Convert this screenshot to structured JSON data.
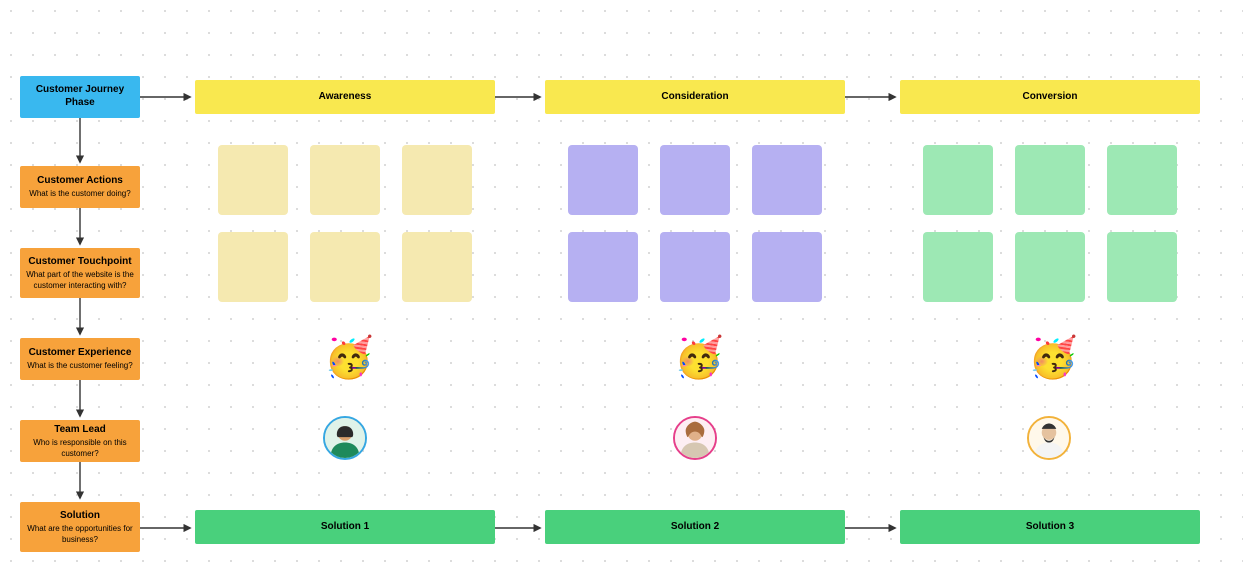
{
  "header": {
    "phase_box": "Customer Journey Phase",
    "phases": [
      "Awareness",
      "Consideration",
      "Conversion"
    ]
  },
  "rows": [
    {
      "title": "Customer Actions",
      "sub": "What is the customer doing?"
    },
    {
      "title": "Customer Touchpoint",
      "sub": "What part of the website is the customer interacting with?"
    },
    {
      "title": "Customer Experience",
      "sub": "What is the customer feeling?"
    },
    {
      "title": "Team Lead",
      "sub": "Who is responsible on this customer?"
    },
    {
      "title": "Solution",
      "sub": "What are the opportunities for business?"
    }
  ],
  "solutions": [
    "Solution 1",
    "Solution 2",
    "Solution 3"
  ],
  "experience_emoji": "🥳",
  "avatars": [
    {
      "border": "#35a7e2",
      "name": "avatar-awareness"
    },
    {
      "border": "#e63e8b",
      "name": "avatar-consideration"
    },
    {
      "border": "#f2b23a",
      "name": "avatar-conversion"
    }
  ],
  "colors": {
    "blue": "#39b8ef",
    "orange": "#f7a23b",
    "yellow": "#f9e84f",
    "green": "#49d07c",
    "sticky_yellow": "#f5e9b0",
    "sticky_purple": "#b6b0f2",
    "sticky_green": "#9de8b4"
  }
}
